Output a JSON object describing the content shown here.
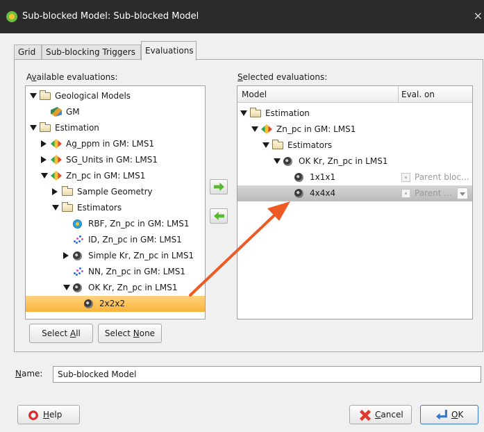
{
  "window": {
    "title": "Sub-blocked Model: Sub-blocked Model",
    "close_glyph": "×"
  },
  "tabs": [
    {
      "label": "Grid",
      "active": false
    },
    {
      "label": "Sub-blocking Triggers",
      "active": false
    },
    {
      "label": "Evaluations",
      "active": true
    }
  ],
  "available": {
    "label_prefix": "A",
    "label_underlined": "v",
    "label_rest": "ailable evaluations:",
    "tree": [
      {
        "text": "Geological Models",
        "icon": "folder-icon",
        "expander": "expanded"
      },
      {
        "text": "GM",
        "icon": "geological-model-icon",
        "expander": "none"
      },
      {
        "text": "Estimation",
        "icon": "folder-icon",
        "expander": "expanded"
      },
      {
        "text": "Ag_ppm in GM: LMS1",
        "icon": "domain-estimation-icon",
        "expander": "collapsed"
      },
      {
        "text": "SG_Units in GM: LMS1",
        "icon": "domain-estimation-icon",
        "expander": "collapsed"
      },
      {
        "text": "Zn_pc in GM: LMS1",
        "icon": "domain-estimation-icon",
        "expander": "expanded"
      },
      {
        "text": "Sample Geometry",
        "icon": "folder-icon",
        "expander": "collapsed"
      },
      {
        "text": "Estimators",
        "icon": "folder-icon",
        "expander": "expanded"
      },
      {
        "text": "RBF, Zn_pc in GM: LMS1",
        "icon": "rbf-estimator-icon",
        "expander": "none"
      },
      {
        "text": "ID, Zn_pc in GM: LMS1",
        "icon": "idw-estimator-icon",
        "expander": "none"
      },
      {
        "text": "Simple Kr, Zn_pc in LMS1",
        "icon": "kriging-estimator-icon",
        "expander": "collapsed"
      },
      {
        "text": "NN, Zn_pc in GM: LMS1",
        "icon": "nn-estimator-icon",
        "expander": "none"
      },
      {
        "text": "OK Kr, Zn_pc in LMS1",
        "icon": "kriging-estimator-icon",
        "expander": "expanded"
      },
      {
        "text": "2x2x2",
        "icon": "kriging-estimator-icon",
        "expander": "none",
        "selected": true
      }
    ]
  },
  "buttons": {
    "select_all_prefix": "Select ",
    "select_all_underlined": "A",
    "select_all_rest": "ll",
    "select_none_prefix": "Select ",
    "select_none_underlined": "N",
    "select_none_rest": "one",
    "help_underlined": "H",
    "help_rest": "elp",
    "cancel_underlined": "C",
    "cancel_rest": "ancel",
    "ok_underlined": "O",
    "ok_rest": "K"
  },
  "selected": {
    "label_underlined": "S",
    "label_rest": "elected evaluations:",
    "columns": [
      "Model",
      "Eval. on"
    ],
    "tree": [
      {
        "text": "Estimation",
        "icon": "folder-icon",
        "expander": "expanded"
      },
      {
        "text": "Zn_pc in GM: LMS1",
        "icon": "domain-estimation-icon",
        "expander": "expanded"
      },
      {
        "text": "Estimators",
        "icon": "folder-icon",
        "expander": "expanded"
      },
      {
        "text": "OK Kr, Zn_pc in LMS1",
        "icon": "kriging-estimator-icon",
        "expander": "expanded"
      },
      {
        "text": "1x1x1",
        "icon": "kriging-estimator-icon",
        "expander": "none",
        "eval_on": "Parent bloc..."
      },
      {
        "text": "4x4x4",
        "icon": "kriging-estimator-icon",
        "expander": "none",
        "eval_on": "Parent ...",
        "selected": true
      }
    ]
  },
  "name_field": {
    "label_underlined": "N",
    "label_rest": "ame:",
    "value": "Sub-blocked Model"
  },
  "colors": {
    "selection_orange": "#f9b43a",
    "annotation_arrow": "#ee5a24",
    "move_arrow_green": "#58b82e"
  }
}
